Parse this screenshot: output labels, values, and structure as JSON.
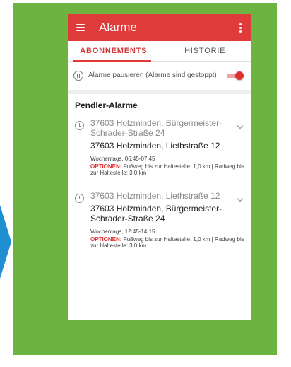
{
  "colors": {
    "green": "#6db33f",
    "red": "#df3b3b",
    "arrow_blue": "#1f8fd1"
  },
  "app": {
    "title": "Alarme",
    "menu_icon": "menu-icon",
    "overflow_icon": "more-vert-icon"
  },
  "tabs": [
    {
      "label": "ABONNEMENTS",
      "active": true
    },
    {
      "label": "HISTORIE",
      "active": false
    }
  ],
  "pause": {
    "label": "Alarme pausieren (Alarme sind gestoppt)",
    "enabled": true
  },
  "section": {
    "title": "Pendler-Alarme"
  },
  "alarms": [
    {
      "from": "37603 Holzminden, Bürgermeister-Schrader-Straße 24",
      "to": "37603 Holzminden, Liethstraße 12",
      "time": "Wochentags, 06:45-07:45",
      "options_label": "OPTIONEN:",
      "options_text": "Fußweg bis zur Haltestelle: 1,0 km | Radweg bis zur Haltestelle: 3,0 km"
    },
    {
      "from": "37603 Holzminden, Liethstraße 12",
      "to": "37603 Holzminden, Bürgermeister-Schrader-Straße 24",
      "time": "Wochentags, 12:45-14:15",
      "options_label": "OPTIONEN:",
      "options_text": "Fußweg bis zur Haltestelle: 1,0 km | Radweg bis zur Haltestelle: 3,0 km"
    }
  ]
}
